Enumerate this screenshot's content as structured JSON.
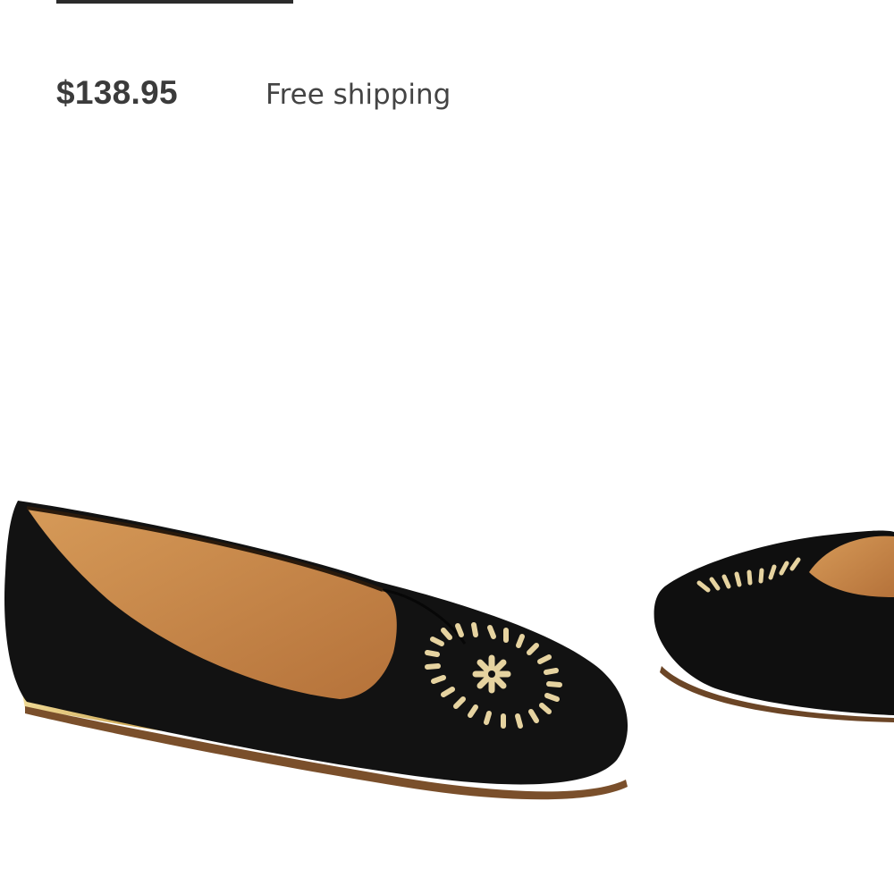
{
  "product": {
    "price": "$138.95",
    "shipping": "Free shipping"
  },
  "image": {
    "icon": "black-suede-loafer-pair",
    "colors": {
      "suede": "#111111",
      "lining": "#c98a4a",
      "whipstitch": "#e6d3a0",
      "heel": "#d8b763"
    }
  }
}
